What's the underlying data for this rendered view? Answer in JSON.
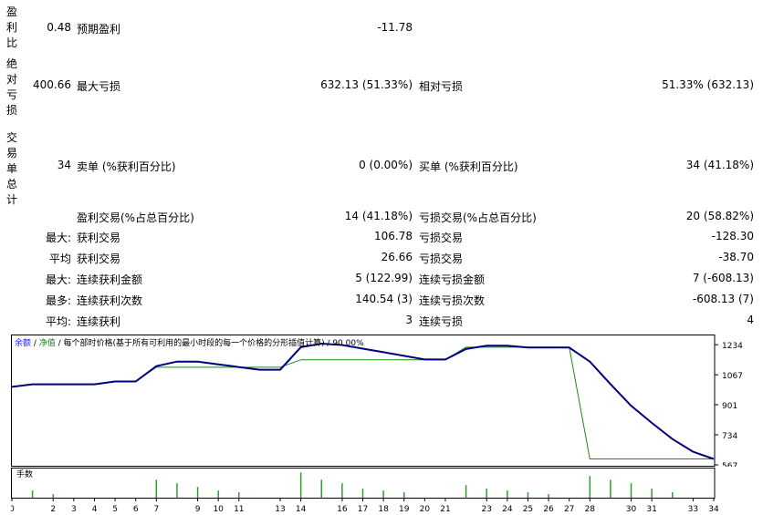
{
  "side_labels": {
    "profit_factor": "盈利比",
    "absolute_dd": "绝对亏损",
    "total_trades": "交易单总计"
  },
  "rows": {
    "profit_factor": {
      "value": "0.48",
      "label": "预期盈利",
      "mid": "-11.78"
    },
    "absolute_dd": {
      "value": "400.66",
      "label": "最大亏损",
      "mid": "632.13 (51.33%)",
      "label2": "相对亏损",
      "right": "51.33% (632.13)"
    },
    "total_trades": {
      "value": "34",
      "label": "卖单 (%获利百分比)",
      "mid": "0 (0.00%)",
      "label2": "买单 (%获利百分比)",
      "right": "34 (41.18%)"
    },
    "profit_trades": {
      "label": "盈利交易(%占总百分比)",
      "mid": "14 (41.18%)",
      "label2": "亏损交易(%占总百分比)",
      "right": "20 (58.82%)"
    },
    "largest": {
      "prefix": "最大:",
      "label": "获利交易",
      "mid": "106.78",
      "label2": "亏损交易",
      "right": "-128.30"
    },
    "average": {
      "prefix": "平均",
      "label": "获利交易",
      "mid": "26.66",
      "label2": "亏损交易",
      "right": "-38.70"
    },
    "max_consec": {
      "prefix": "最大:",
      "label": "连续获利金额",
      "mid": "5 (122.99)",
      "label2": "连续亏损金额",
      "right": "7 (-608.13)"
    },
    "max_count": {
      "prefix": "最多:",
      "label": "连续获利次数",
      "mid": "140.54 (3)",
      "label2": "连续亏损次数",
      "right": "-608.13 (7)"
    },
    "avg_consec": {
      "prefix": "平均:",
      "label": "连续获利",
      "mid": "3",
      "label2": "连续亏损",
      "right": "4"
    }
  },
  "legend": {
    "balance": "余额",
    "sep1": " / ",
    "equity": "净值",
    "rest": " / 每个部时价格(基于所有可利用的最小时段的每一个价格的分形插值计算) / 90.00%"
  },
  "volume_label": "手数",
  "colors": {
    "balance": "#00007f",
    "equity": "#1a8a1a",
    "volume": "#2aa02a"
  },
  "chart_data": [
    {
      "type": "line",
      "x": [
        0,
        1,
        2,
        3,
        4,
        5,
        6,
        7,
        8,
        9,
        10,
        11,
        12,
        13,
        14,
        15,
        16,
        17,
        18,
        19,
        20,
        21,
        22,
        23,
        24,
        25,
        26,
        27,
        28,
        29,
        30,
        31,
        32,
        33,
        34
      ],
      "series": [
        {
          "name": "余额",
          "values": [
            1000,
            1014,
            1014,
            1014,
            1014,
            1030,
            1030,
            1109,
            1109,
            1109,
            1109,
            1109,
            1109,
            1109,
            1150,
            1150,
            1150,
            1150,
            1150,
            1150,
            1150,
            1150,
            1220,
            1220,
            1220,
            1220,
            1220,
            1220,
            600,
            600,
            600,
            600,
            600,
            600,
            600
          ]
        },
        {
          "name": "净值",
          "values": [
            1000,
            1014,
            1014,
            1014,
            1014,
            1030,
            1030,
            1115,
            1140,
            1140,
            1125,
            1110,
            1095,
            1095,
            1220,
            1240,
            1232,
            1212,
            1192,
            1172,
            1152,
            1152,
            1210,
            1228,
            1228,
            1218,
            1218,
            1218,
            1140,
            1015,
            895,
            800,
            710,
            640,
            600
          ]
        }
      ],
      "y_ticks": [
        1234,
        1067,
        901,
        734,
        567
      ],
      "ylim": [
        567,
        1260
      ],
      "xlim": [
        0,
        34
      ],
      "y_axis_position": "right"
    },
    {
      "type": "bar",
      "title": "手数",
      "x_ticks": [
        0,
        2,
        3,
        4,
        5,
        6,
        7,
        9,
        10,
        11,
        13,
        14,
        16,
        17,
        18,
        19,
        20,
        21,
        23,
        24,
        25,
        26,
        27,
        28,
        30,
        31,
        33,
        34
      ],
      "x": [
        1,
        2,
        7,
        8,
        9,
        10,
        11,
        14,
        15,
        16,
        17,
        18,
        19,
        22,
        23,
        24,
        25,
        26,
        28,
        29,
        30,
        31,
        32
      ],
      "values": [
        0.4,
        0.2,
        1.0,
        0.8,
        0.6,
        0.4,
        0.3,
        1.4,
        1.0,
        0.8,
        0.5,
        0.4,
        0.3,
        0.7,
        0.5,
        0.4,
        0.3,
        0.2,
        1.2,
        1.0,
        0.8,
        0.5,
        0.3
      ]
    }
  ]
}
